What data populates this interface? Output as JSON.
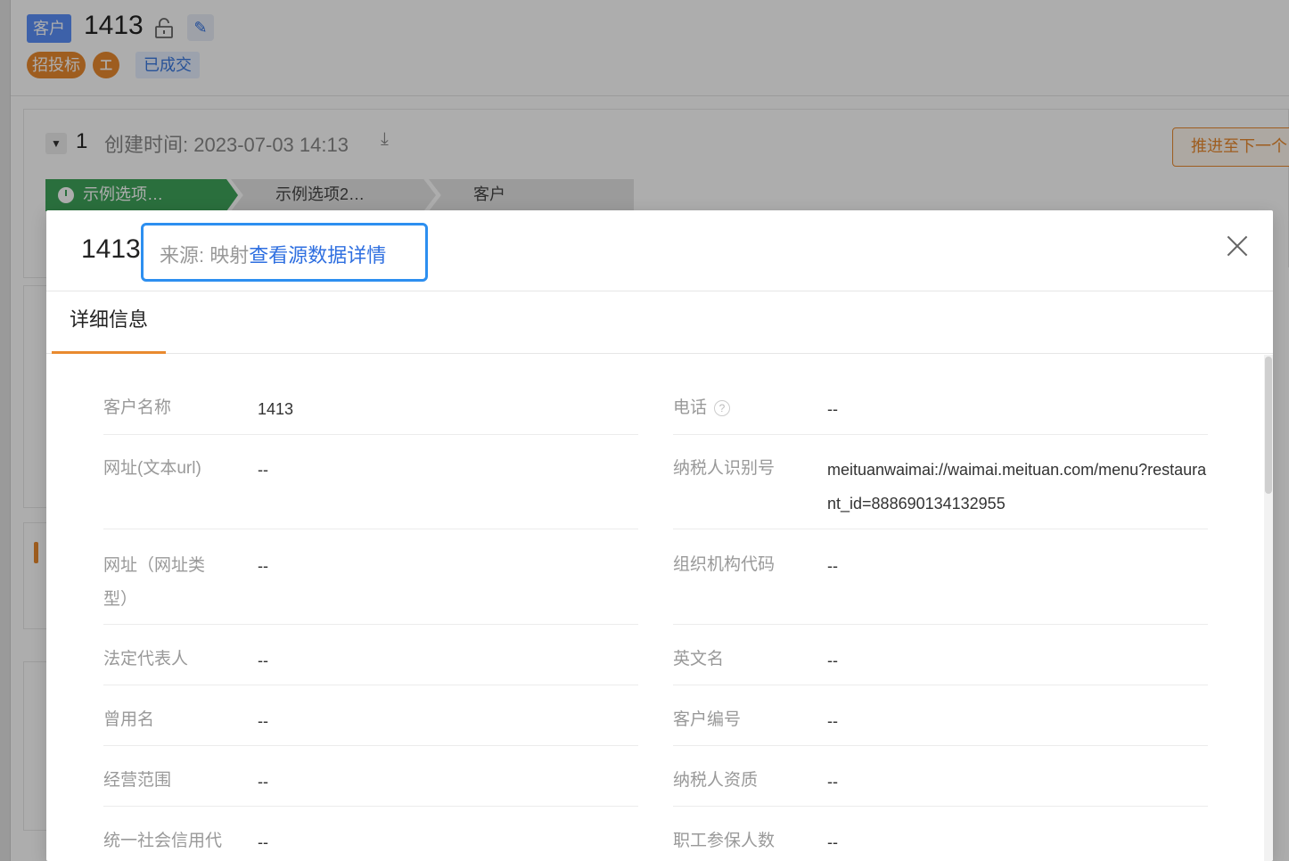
{
  "header": {
    "type_tag": "客户",
    "title": "1413",
    "tags": [
      "招投标",
      "工"
    ],
    "status_tag": "已成交"
  },
  "stage_card": {
    "stage_number": "1",
    "created_label": "创建时间:",
    "created_value": "2023-07-03 14:13",
    "next_button": "推进至下一个",
    "steps": [
      "示例选项…",
      "示例选项2…",
      "客户"
    ]
  },
  "modal": {
    "title": "1413",
    "source_label": "来源: 映射",
    "source_link": "查看源数据详情",
    "tab": "详细信息",
    "fields_left": [
      {
        "label": "客户名称",
        "value": "1413"
      },
      {
        "label": "网址(文本url)",
        "value": "--"
      },
      {
        "label": "网址（网址类型）",
        "value": "--"
      },
      {
        "label": "法定代表人",
        "value": "--"
      },
      {
        "label": "曾用名",
        "value": "--"
      },
      {
        "label": "经营范围",
        "value": "--"
      },
      {
        "label": "统一社会信用代",
        "value": "--"
      }
    ],
    "fields_right": [
      {
        "label": "电话",
        "value": "--"
      },
      {
        "label": "纳税人识别号",
        "value": "meituanwaimai://waimai.meituan.com/menu?restaurant_id=888690134132955"
      },
      {
        "label": "组织机构代码",
        "value": "--"
      },
      {
        "label": "英文名",
        "value": "--"
      },
      {
        "label": "客户编号",
        "value": "--"
      },
      {
        "label": "纳税人资质",
        "value": "--"
      },
      {
        "label": "职工参保人数",
        "value": "--"
      }
    ]
  },
  "colors": {
    "accent_orange": "#e98a2f",
    "link_blue": "#2f6fe0",
    "highlight_border": "#2d8ff0",
    "stage_green": "#3fa45b"
  }
}
